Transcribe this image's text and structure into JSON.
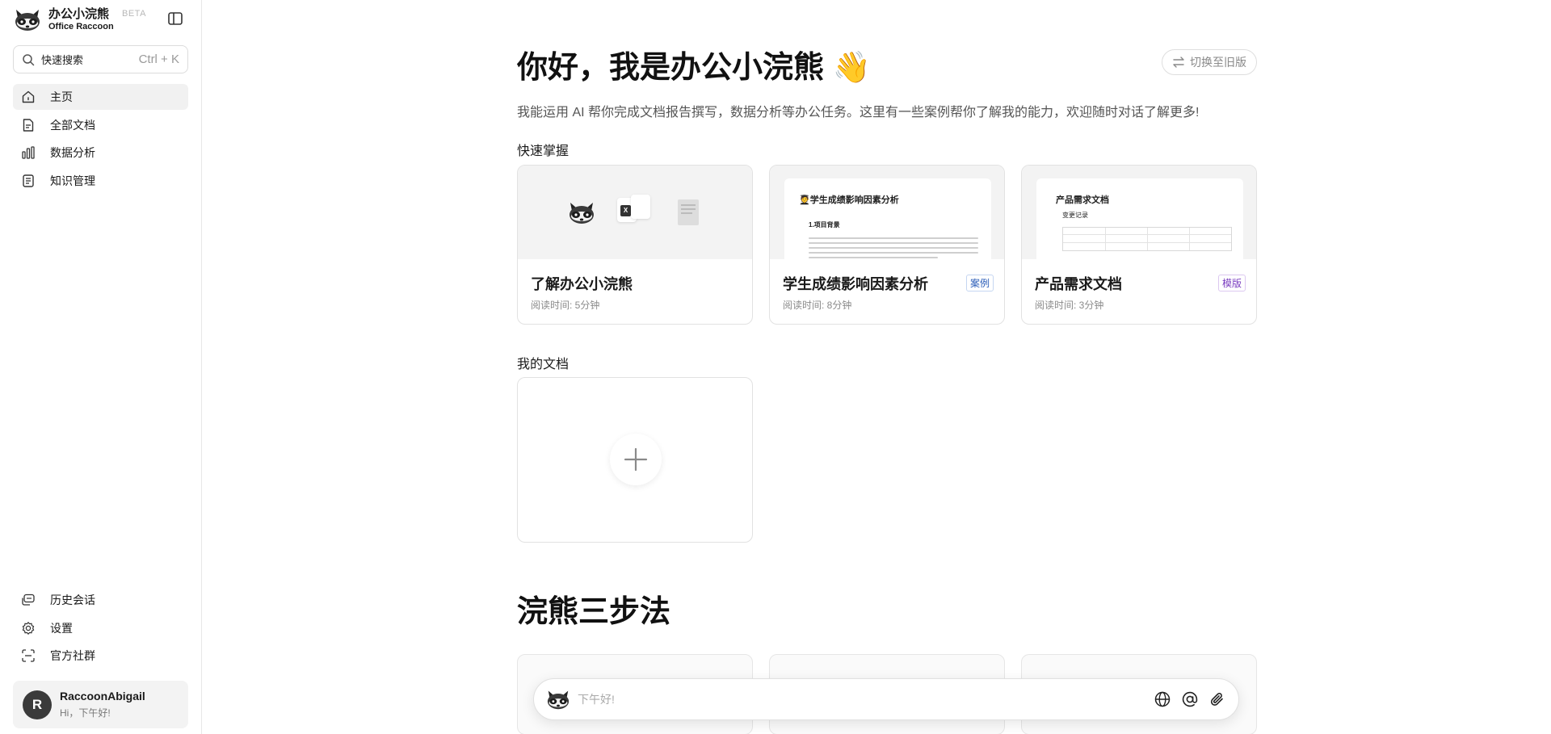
{
  "brand": {
    "name_cn": "办公小浣熊",
    "name_en": "Office Raccoon",
    "badge": "BETA"
  },
  "search": {
    "label": "快速搜索",
    "shortcut": "Ctrl + K"
  },
  "nav": {
    "items": [
      {
        "label": "主页",
        "icon": "home-icon",
        "active": true
      },
      {
        "label": "全部文档",
        "icon": "document-icon"
      },
      {
        "label": "数据分析",
        "icon": "bar-chart-icon"
      },
      {
        "label": "知识管理",
        "icon": "knowledge-icon"
      }
    ],
    "bottom": [
      {
        "label": "历史会话",
        "icon": "chat-history-icon"
      },
      {
        "label": "设置",
        "icon": "gear-icon"
      },
      {
        "label": "官方社群",
        "icon": "community-icon"
      }
    ]
  },
  "user": {
    "initial": "R",
    "name": "RaccoonAbigail",
    "greeting": "Hi，下午好!"
  },
  "hero": {
    "title": "你好，我是办公小浣熊 👋",
    "description": "我能运用 AI 帮你完成文档报告撰写，数据分析等办公任务。这里有一些案例帮你了解我的能力，欢迎随时对话了解更多!",
    "switch_label": "切换至旧版"
  },
  "quick": {
    "title": "快速掌握",
    "cards": [
      {
        "title": "了解办公小浣熊",
        "meta": "阅读时间: 5分钟",
        "tag": ""
      },
      {
        "title": "学生成绩影响因素分析",
        "meta": "阅读时间: 8分钟",
        "tag": "案例",
        "preview_heading": "🧑‍🎓学生成绩影响因素分析",
        "preview_sub": "1.项目背景"
      },
      {
        "title": "产品需求文档",
        "meta": "阅读时间: 3分钟",
        "tag": "模版",
        "preview_heading": "产品需求文档",
        "preview_sub": "变更记录"
      }
    ]
  },
  "my_docs": {
    "title": "我的文档"
  },
  "steps": {
    "title": "浣熊三步法"
  },
  "chat": {
    "placeholder": "下午好!"
  },
  "colors": {
    "accent_case": "#2b5db8",
    "accent_template": "#7b3fc0",
    "active_nav_bg": "#f1f1f1"
  }
}
